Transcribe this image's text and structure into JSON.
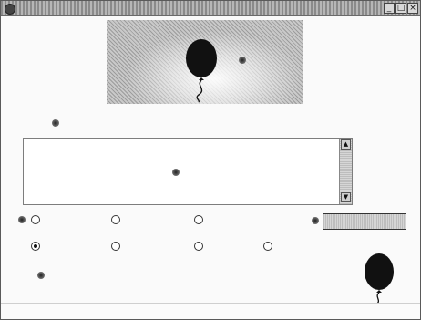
{
  "window": {
    "title": "",
    "minimize_label": "_",
    "maximize_label": "□",
    "close_label": "×"
  },
  "banner": {
    "balloon_color": "#111111"
  },
  "input_section": {
    "label": "",
    "text_value": ""
  },
  "options_row1": {
    "items": [
      {
        "label": "",
        "checked": false
      },
      {
        "label": "",
        "checked": false
      },
      {
        "label": "",
        "checked": false
      }
    ],
    "button_label": ""
  },
  "options_row2": {
    "items": [
      {
        "label": "",
        "checked": true
      },
      {
        "label": "",
        "checked": false
      },
      {
        "label": "",
        "checked": false
      },
      {
        "label": "",
        "checked": false
      }
    ]
  },
  "status": {
    "text": ""
  },
  "icons": {
    "window_icon": "app-icon",
    "balloon_icon": "balloon-icon"
  },
  "colors": {
    "window_background": "#fafafa",
    "titlebar": "#9a9a9a",
    "balloon": "#111111"
  }
}
